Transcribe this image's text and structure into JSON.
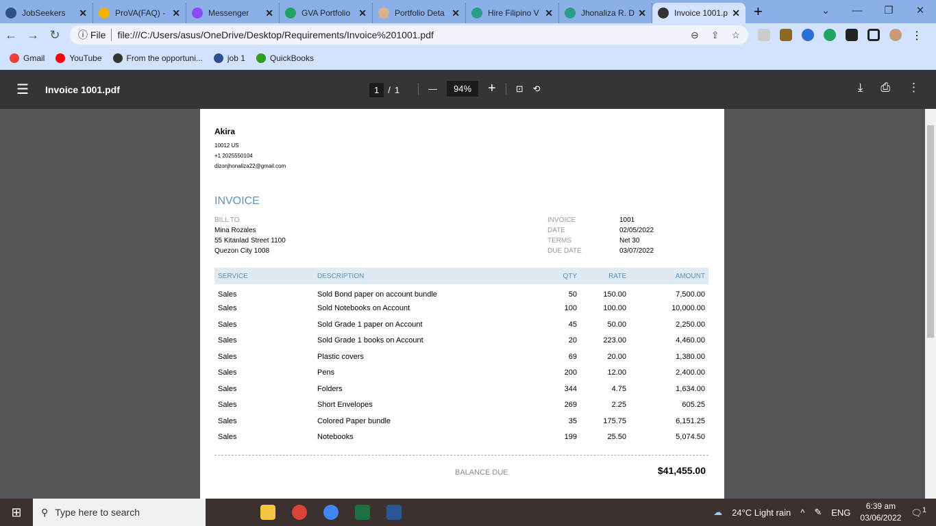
{
  "browser": {
    "tabs": [
      {
        "label": "JobSeekers",
        "color": "#2f4f8f"
      },
      {
        "label": "ProVA(FAQ) -",
        "color": "#f0b400"
      },
      {
        "label": "Messenger",
        "color": "#8a4cf0"
      },
      {
        "label": "GVA Portfolio",
        "color": "#1fa463"
      },
      {
        "label": "Portfolio Deta",
        "color": "#d9b08c"
      },
      {
        "label": "Hire Filipino V",
        "color": "#2c9c8a"
      },
      {
        "label": "Jhonaliza R. D",
        "color": "#2c9c8a"
      },
      {
        "label": "Invoice 1001.p",
        "color": "#333333"
      }
    ],
    "url_scheme": "File",
    "url": "file:///C:/Users/asus/OneDrive/Desktop/Requirements/Invoice%201001.pdf",
    "bookmarks": [
      "Gmail",
      "YouTube",
      "From the opportuni...",
      "job 1",
      "QuickBooks"
    ]
  },
  "viewer": {
    "title": "Invoice 1001.pdf",
    "page": "1",
    "total": "1",
    "zoom": "94%"
  },
  "invoice": {
    "sender": {
      "name": "Akira",
      "address": "10012 US",
      "phone": "+1 2025550104",
      "email": "dizonjhonaliza22@gmail.com"
    },
    "heading": "INVOICE",
    "bill_to_label": "BILL TO",
    "bill_to": [
      "Mina Rozales",
      "55 Kitanlad Street 1100",
      "Quezon City  1008"
    ],
    "meta": [
      [
        "INVOICE",
        "1001"
      ],
      [
        "DATE",
        "02/05/2022"
      ],
      [
        "TERMS",
        "Net 30"
      ],
      [
        "DUE DATE",
        "03/07/2022"
      ]
    ],
    "columns": [
      "SERVICE",
      "DESCRIPTION",
      "QTY",
      "RATE",
      "AMOUNT"
    ],
    "rows": [
      [
        "Sales",
        "Sold Bond paper on account bundle",
        "50",
        "150.00",
        "7,500.00"
      ],
      [
        "Sales",
        "Sold Notebooks on Account",
        "100",
        "100.00",
        "10,000.00"
      ],
      [
        "Sales",
        "Sold Grade 1 paper on Account",
        "45",
        "50.00",
        "2,250.00"
      ],
      [
        "Sales",
        "Sold Grade 1 books on Account",
        "20",
        "223.00",
        "4,460.00"
      ],
      [
        "Sales",
        "Plastic covers",
        "69",
        "20.00",
        "1,380.00"
      ],
      [
        "Sales",
        "Pens",
        "200",
        "12.00",
        "2,400.00"
      ],
      [
        "Sales",
        "Folders",
        "344",
        "4.75",
        "1,634.00"
      ],
      [
        "Sales",
        "Short Envelopes",
        "269",
        "2.25",
        "605.25"
      ],
      [
        "Sales",
        "Colored Paper bundle",
        "35",
        "175.75",
        "6,151.25"
      ],
      [
        "Sales",
        "Notebooks",
        "199",
        "25.50",
        "5,074.50"
      ]
    ],
    "balance_label": "BALANCE DUE",
    "balance": "$41,455.00"
  },
  "taskbar": {
    "search_placeholder": "Type here to search",
    "weather": "24°C  Light rain",
    "lang": "ENG",
    "time": "6:39 am",
    "date": "03/06/2022",
    "notifications": "1"
  }
}
